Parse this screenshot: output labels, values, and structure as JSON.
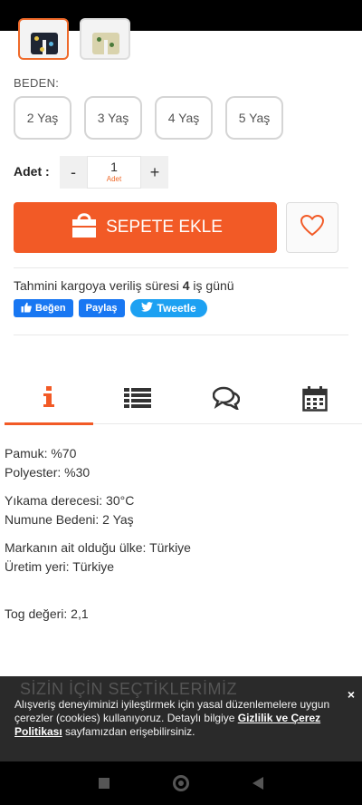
{
  "product": {
    "size_label": "BEDEN:",
    "sizes": [
      "2 Yaş",
      "3 Yaş",
      "4 Yaş",
      "5 Yaş"
    ],
    "quantity_label": "Adet :",
    "quantity": {
      "minus": "-",
      "value": "1",
      "unit": "Adet",
      "plus": "+"
    },
    "add_to_cart": "SEPETE EKLE",
    "shipping": {
      "prefix": "Tahmini kargoya veriliş süresi",
      "days": "4",
      "suffix": "iş günü"
    },
    "social": {
      "like": "Beğen",
      "share": "Paylaş",
      "tweet": "Tweetle"
    }
  },
  "tabs": [
    {
      "icon": "info-icon",
      "active": true
    },
    {
      "icon": "list-icon",
      "active": false
    },
    {
      "icon": "comments-icon",
      "active": false
    },
    {
      "icon": "calendar-icon",
      "active": false
    }
  ],
  "details": {
    "line1": "Pamuk: %70",
    "line2": "Polyester: %30",
    "line3": "Yıkama derecesi: 30°C",
    "line4": "Numune Bedeni: 2 Yaş",
    "line5": "Markanın ait olduğu ülke: Türkiye",
    "line6": "Üretim yeri: Türkiye",
    "line7": "Tog değeri: 2,1"
  },
  "cookie": {
    "behind_heading": "SİZİN İÇİN SEÇTİKLERİMİZ",
    "text_before": "Alışveriş deneyiminizi iyileştirmek için yasal düzenlemelere uygun çerezler (cookies) kullanıyoruz. Detaylı bilgiye ",
    "link": "Gizlilik ve Çerez Politikası",
    "text_after": " sayfamızdan erişebilirsiniz.",
    "close": "×"
  },
  "colors": {
    "accent": "#f25a26",
    "facebook": "#1877f2",
    "twitter": "#1da1f2"
  }
}
